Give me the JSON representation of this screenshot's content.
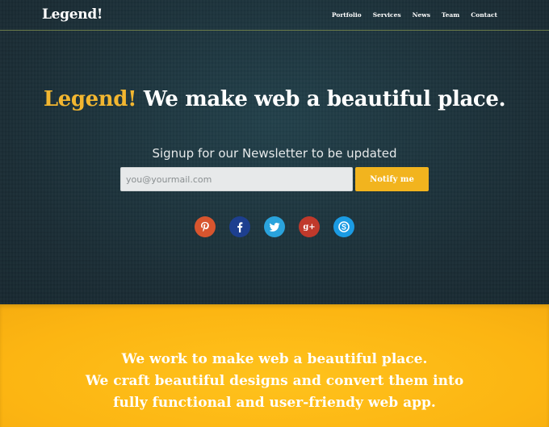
{
  "brand": "Legend!",
  "nav": {
    "items": [
      {
        "label": "Portfolio"
      },
      {
        "label": "Services"
      },
      {
        "label": "News"
      },
      {
        "label": "Team"
      },
      {
        "label": "Contact"
      }
    ]
  },
  "hero": {
    "headline_accent": "Legend!",
    "headline_rest": " We make web a beautiful place.",
    "signup_label": "Signup for our Newsletter to be updated",
    "email_placeholder": "you@yourmail.com",
    "notify_label": "Notify me"
  },
  "social": [
    {
      "icon": "pinterest-icon",
      "glyph": "P",
      "color": "#d8552e"
    },
    {
      "icon": "facebook-icon",
      "glyph": "f",
      "color": "#1d3f8f"
    },
    {
      "icon": "twitter-icon",
      "glyph": "t",
      "color": "#2aa3dc"
    },
    {
      "icon": "google-plus-icon",
      "glyph": "g+",
      "color": "#c0392b"
    },
    {
      "icon": "skype-icon",
      "glyph": "S",
      "color": "#1b9be3"
    }
  ],
  "tagline": {
    "line1": "We work to make web a beautiful place.",
    "line2": "We craft beautiful designs and convert them into",
    "line3": "fully functional and user-friendy web app."
  },
  "colors": {
    "accent": "#f2b630",
    "hero_bg": "#1c3039",
    "yellow_bg": "#fdb714"
  }
}
